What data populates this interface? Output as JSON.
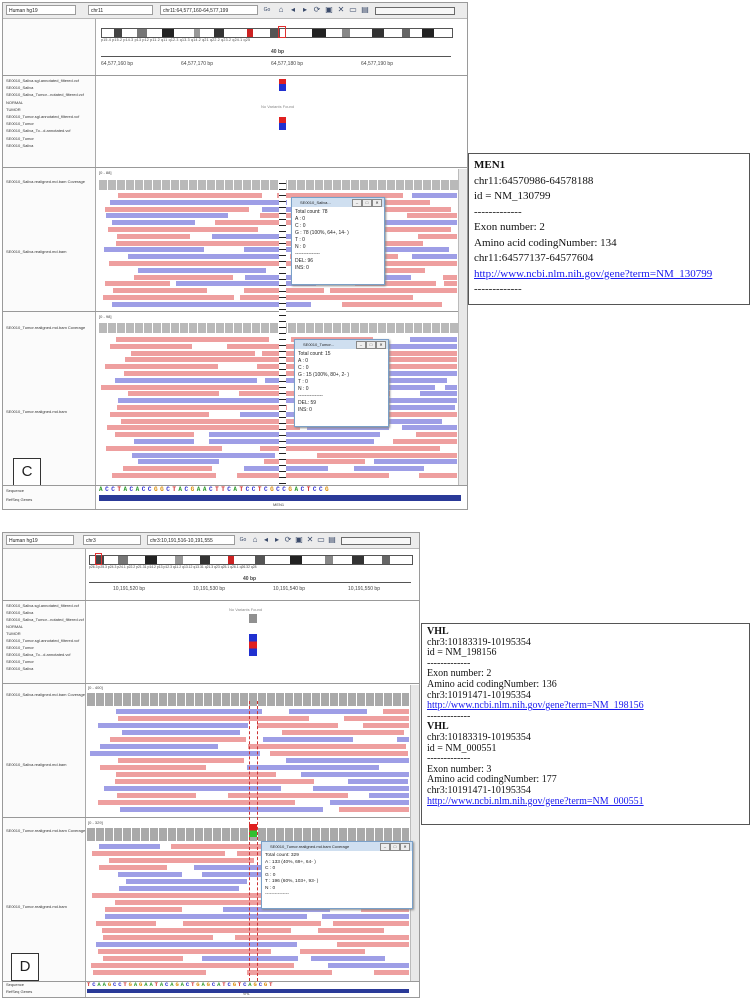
{
  "panel_c": {
    "genome": "Human hg19",
    "chromosome": "chr11",
    "locus": "chr11:64,577,160-64,577,199",
    "scale_label": "40 bp",
    "positions": [
      "64,577,160 bp",
      "64,577,170 bp",
      "64,577,180 bp",
      "64,577,190 bp"
    ],
    "bands": [
      "p15.4",
      "p15.2",
      "p14.3",
      "p13",
      "p12",
      "p11.2",
      "q11",
      "q12.3",
      "q13.3",
      "q14.2",
      "q21",
      "q22.2",
      "q23.2",
      "q24.1",
      "q25"
    ],
    "track_labels": [
      "SE0010_Saliva.sgl.annotated_filtered.vcf",
      "SE0010_Saliva",
      "SE0010_Saliva_Tumor...notated_filtered.vcf",
      "NORMAL",
      "TUMOR",
      "SE0010_Tumor.sgl.annotated_filtered.vcf",
      "SE0010_Tumor",
      "SE0010_Saliva_To...d.annotated.vcf",
      "SE0010_Tumor",
      "SE0010_Saliva"
    ],
    "no_variants": "No Variants Found",
    "saliva_cov_label": "SE0010_Saliva.realigned.md.bam Coverage",
    "saliva_cov_range": "[0 - 88]",
    "saliva_bam_label": "SE0010_Saliva.realigned.md.bam",
    "tumor_cov_label": "SE0010_Tumor.realigned.md.bam Coverage",
    "tumor_cov_range": "[0 - 98]",
    "tumor_bam_label": "SE0010_Tumor.realigned.md.bam",
    "popup_saliva": {
      "title": "SE0010_Saliva...",
      "lines": [
        "Total count: 78",
        "A : 0",
        "C : 0",
        "G : 78 (100%, 64+, 14- )",
        "T : 0",
        "N : 0",
        "---------------",
        "DEL: 96",
        "INS: 0"
      ]
    },
    "popup_tumor": {
      "title": "SE0010_Tumor...",
      "lines": [
        "Total count: 15",
        "A : 0",
        "C : 0",
        "G : 15 (100%, 80+, 2- )",
        "T : 0",
        "N : 0",
        "---------------",
        "DEL: 59",
        "INS: 0"
      ]
    },
    "sequence_label": "Sequence",
    "refseq_label": "RefSeq Genes",
    "sequence": "A C C T A C A C C G G C T A C G A A C T T C A T C C T C G C C G A C T C C G",
    "gene_label": "MEN1",
    "letter": "C",
    "info": {
      "gene": "MEN1",
      "coords": "chr11:64570986-64578188",
      "id": "id = NM_130799",
      "sep": "-------------",
      "exon": "Exon number: 2",
      "aa": "Amino acid codingNumber: 134",
      "exon_coords": "chr11:64577137-64577604",
      "link": "http://www.ncbi.nlm.nih.gov/gene?term=NM_130799",
      "sep2": "-------------"
    }
  },
  "panel_d": {
    "genome": "Human hg19",
    "chromosome": "chr3",
    "locus": "chr3:10,191,516-10,191,555",
    "scale_label": "40 bp",
    "positions": [
      "10,191,520 bp",
      "10,191,530 bp",
      "10,191,540 bp",
      "10,191,550 bp"
    ],
    "bands": [
      "p26.3",
      "p25.3",
      "p24.3",
      "p24.1",
      "p22.2",
      "p21.31",
      "p14.2",
      "p13",
      "p12.3",
      "q11.2",
      "q13.12",
      "q13.31",
      "q21.3",
      "q23",
      "q25.1",
      "q26.1",
      "q26.32",
      "q28"
    ],
    "track_labels": [
      "SE0010_Saliva.sgl.annotated_filtered.vcf",
      "SE0010_Saliva",
      "SE0010_Saliva_Tumor...notated_filtered.vcf",
      "NORMAL",
      "TUMOR",
      "SE0010_Tumor.sgl.annotated_filtered.vcf",
      "SE0010_Tumor",
      "SE0010_Saliva_To...d.annotated.vcf",
      "SE0010_Tumor",
      "SE0010_Saliva"
    ],
    "no_variants": "No Variants Found",
    "saliva_cov_label": "SE0010_Saliva.realigned.md.bam Coverage",
    "saliva_cov_range": "[0 - 400]",
    "saliva_bam_label": "SE0010_Saliva.realigned.md.bam",
    "tumor_cov_label": "SE0010_Tumor.realigned.md.bam Coverage",
    "tumor_cov_range": "[0 - 329]",
    "tumor_bam_label": "SE0010_Tumor.realigned.md.bam",
    "popup_tumor": {
      "title": "SE0010_Tumor.realigned.md.bam Coverage",
      "lines": [
        "Total count: 329",
        "A : 133 (40%, 69+, 64- )",
        "C : 0",
        "G : 0",
        "T : 196 (60%, 103+, 93- )",
        "N : 0",
        "---------------"
      ]
    },
    "sequence_label": "Sequence",
    "refseq_label": "RefSeq Genes",
    "sequence": "T C A A G C C T G A G A A T A C A G A C T G A G C A T C G T C A G C G T",
    "gene_label": "VHL",
    "letter": "D",
    "info": {
      "gene1": "VHL",
      "coords1": "chr3:10183319-10195354",
      "id1": "id = NM_198156",
      "sep1": "-------------",
      "exon1": "Exon number: 2",
      "aa1": "Amino acid codingNumber: 136",
      "exon_coords1": "chr3:10191471-10195354",
      "link1": "http://www.ncbi.nlm.nih.gov/gene?term=NM_198156",
      "sep_mid": "-------------",
      "gene2": "VHL",
      "coords2": "chr3:10183319-10195354",
      "id2": "id = NM_000551",
      "sep2": "-------------",
      "exon2": "Exon number: 3",
      "aa2": "Amino acid codingNumber: 177",
      "exon_coords2": "chr3:10191471-10195354",
      "link2": "http://www.ncbi.nlm.nih.gov/gene?term=NM_000551"
    }
  },
  "colors": {
    "read_forward": "#ee9f9f",
    "read_reverse": "#9e9ee6",
    "variant_het_red": "#e02020",
    "variant_het_blue": "#2030d0",
    "coverage_gray": "#b9b9b9",
    "link_blue": "#1a1aee"
  }
}
